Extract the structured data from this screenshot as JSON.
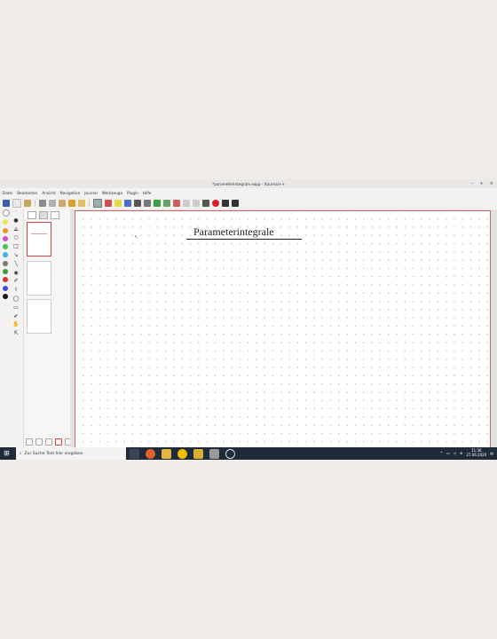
{
  "window": {
    "title": "*parameterintegrale.xopp - Xournal++",
    "controls": [
      "–",
      "+",
      "×"
    ]
  },
  "menu": [
    "Datei",
    "Bearbeiten",
    "Ansicht",
    "Navigation",
    "Journal",
    "Werkzeuge",
    "Plugin",
    "Hilfe"
  ],
  "palette_colors": [
    "#ffffff",
    "#e8e84a",
    "#ef8f2c",
    "#d44bd0",
    "#48c24b",
    "#3ab4e0",
    "#777777",
    "#3a9a3a",
    "#d23434",
    "#3b4fd0",
    "#111111"
  ],
  "page": {
    "heading": "Parameterintegrale"
  },
  "taskbar": {
    "search_placeholder": "Zur Suche Text hier eingeben",
    "time": "11:36",
    "date": "27.06.2020"
  }
}
